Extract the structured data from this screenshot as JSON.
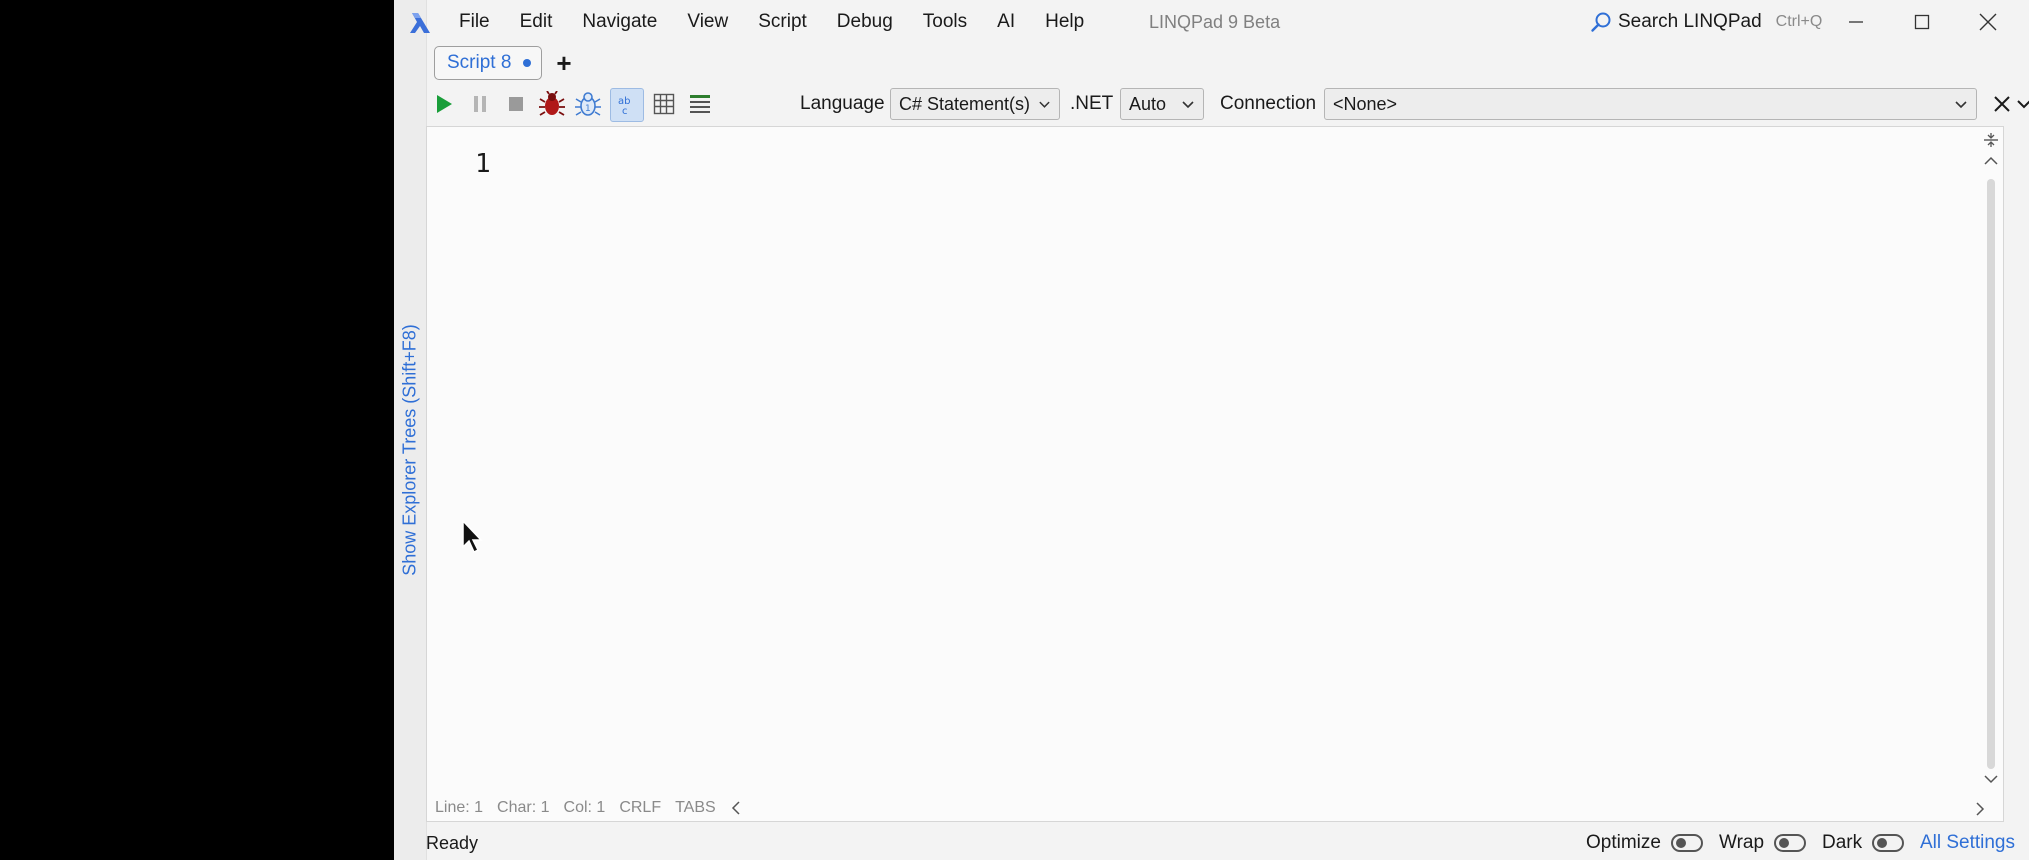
{
  "app": {
    "title": "LINQPad 9 Beta",
    "menu": [
      "File",
      "Edit",
      "Navigate",
      "View",
      "Script",
      "Debug",
      "Tools",
      "AI",
      "Help"
    ],
    "search_label": "Search LINQPad",
    "search_shortcut": "Ctrl+Q"
  },
  "explorer_toggle": "Show Explorer Trees (Shift+F8)",
  "tabs": [
    {
      "label": "Script 8",
      "modified": true
    }
  ],
  "tab_add": "+",
  "toolbar": {
    "language_label": "Language",
    "language_value": "C# Statement(s)",
    "net_label": ".NET",
    "net_value": "Auto",
    "connection_label": "Connection",
    "connection_value": "<None>"
  },
  "editor": {
    "line_numbers": [
      "1"
    ],
    "status": {
      "line": "Line: 1",
      "char": "Char: 1",
      "col": "Col: 1",
      "eol": "CRLF",
      "indent": "TABS"
    }
  },
  "statusbar": {
    "ready": "Ready",
    "optimize": "Optimize",
    "wrap": "Wrap",
    "dark": "Dark",
    "all_settings": "All Settings"
  },
  "colors": {
    "accent": "#2f6fd6",
    "run_green": "#1a9e3a",
    "bug_red": "#b01818"
  }
}
